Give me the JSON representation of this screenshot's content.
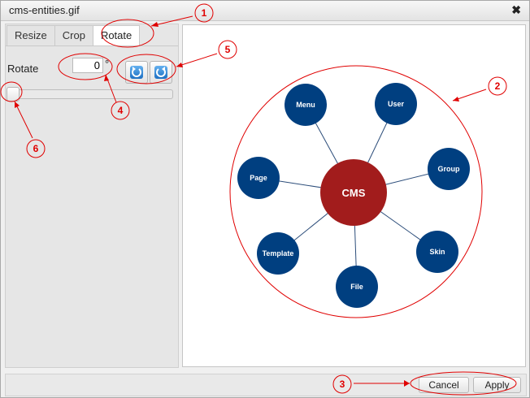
{
  "window": {
    "title": "cms-entities.gif",
    "close_glyph": "✖"
  },
  "tabs": [
    {
      "label": "Resize",
      "active": false
    },
    {
      "label": "Crop",
      "active": false
    },
    {
      "label": "Rotate",
      "active": true
    }
  ],
  "rotate": {
    "label": "Rotate",
    "value": "0",
    "unit": "°",
    "slider_value_degrees": 0
  },
  "rotate_buttons": {
    "left_icon": "rotate-left-icon",
    "right_icon": "rotate-right-icon"
  },
  "diagram": {
    "center": "CMS",
    "nodes": [
      "Menu",
      "User",
      "Group",
      "Skin",
      "File",
      "Template",
      "Page"
    ],
    "center_color": "#a21c1c",
    "node_color": "#003f80"
  },
  "buttons": {
    "cancel": "Cancel",
    "apply": "Apply"
  },
  "annotations": [
    "1",
    "2",
    "3",
    "4",
    "5",
    "6"
  ],
  "colors": {
    "annotation": "#e00000"
  }
}
